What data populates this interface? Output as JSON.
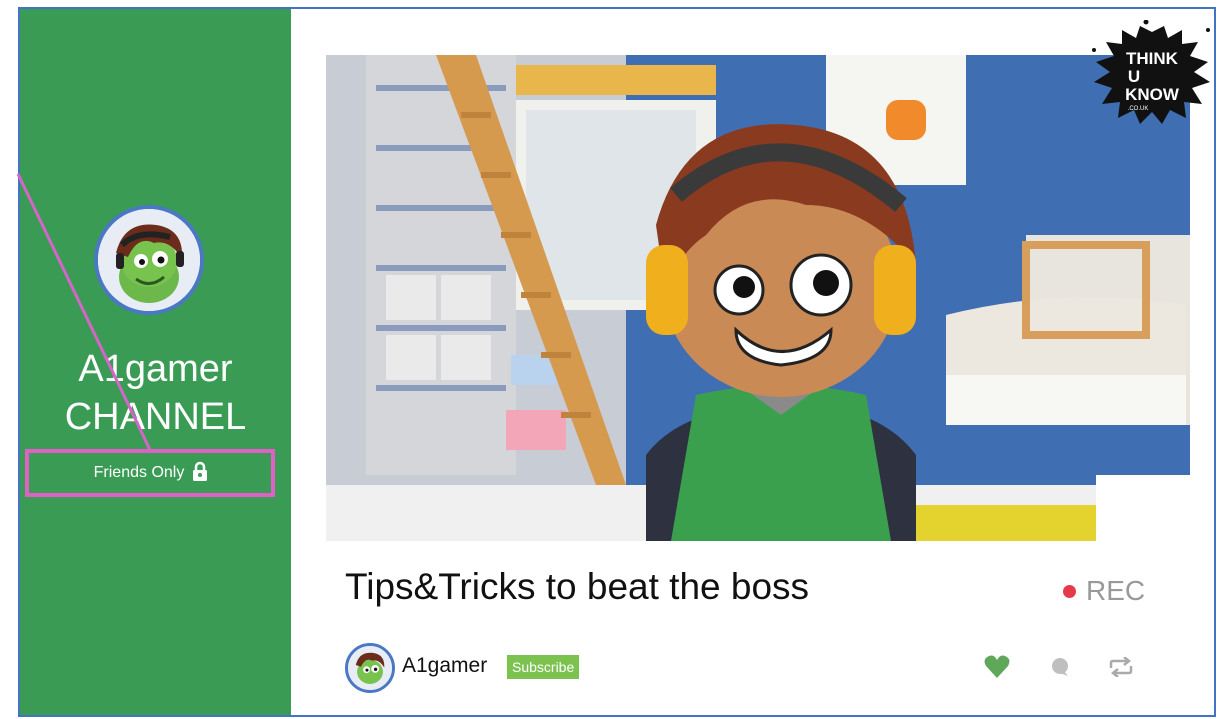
{
  "sidebar": {
    "channel_name_line1": "A1gamer",
    "channel_name_line2": "CHANNEL",
    "privacy_badge": "Friends Only"
  },
  "logo": {
    "line1": "THINK",
    "line2": "U",
    "line3": "KNOW",
    "domain": ".CO.UK"
  },
  "video": {
    "title": "Tips&Tricks to beat the boss",
    "rec_label": "REC"
  },
  "author": {
    "username": "A1gamer",
    "subscribe_label": "Subscribe"
  },
  "colors": {
    "sidebar": "#3a9b55",
    "highlight": "#e060c8",
    "rec": "#e53a4a",
    "like": "#5fa85a",
    "subscribe": "#7bc24f"
  },
  "icons": [
    "padlock-icon",
    "heart-icon",
    "comment-icon",
    "repost-icon"
  ]
}
